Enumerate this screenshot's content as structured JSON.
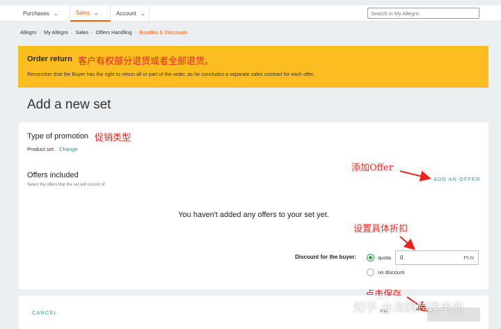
{
  "nav": {
    "items": [
      {
        "label": "Purchases"
      },
      {
        "label": "Sales"
      },
      {
        "label": "Account"
      }
    ],
    "search_placeholder": "Search in My Allegro"
  },
  "breadcrumb": [
    "Allegro",
    "My Allegro",
    "Sales",
    "Offers Handling",
    "Bundles & Discounts"
  ],
  "alert": {
    "title": "Order return",
    "annotation": "客户有权部分退货或者全部退货。",
    "text": "Remember that the Buyer has the right to return all or part of the order, as he concludes a separate sales contract for each offer."
  },
  "page_title": "Add a new set",
  "promotion": {
    "title": "Type of promotion",
    "annotation": "促销类型",
    "value": "Product set.",
    "change_label": "Change"
  },
  "offers": {
    "title": "Offers included",
    "hint": "Select the offers that the set will consist of.",
    "annotation": "添加Offer",
    "add_label": "ADD AN OFFER",
    "empty_text": "You haven't added any offers to your set yet."
  },
  "discount": {
    "annotation": "设置具体折扣",
    "label": "Discount for the buyer:",
    "option_quota": "quota",
    "option_none": "no discount",
    "value": "0",
    "unit": "PLN",
    "selected": "quota"
  },
  "footer": {
    "cancel_label": "CANCEL",
    "save_annotation": "点击保存",
    "add_text": "Add"
  },
  "watermark": "知乎 @海鸥跨境电商",
  "colors": {
    "accent": "#ff5a00",
    "alert_bg": "#fbbd1f",
    "link": "#2a9c8e",
    "annotation": "#e8261f",
    "radio": "#2ca043"
  }
}
